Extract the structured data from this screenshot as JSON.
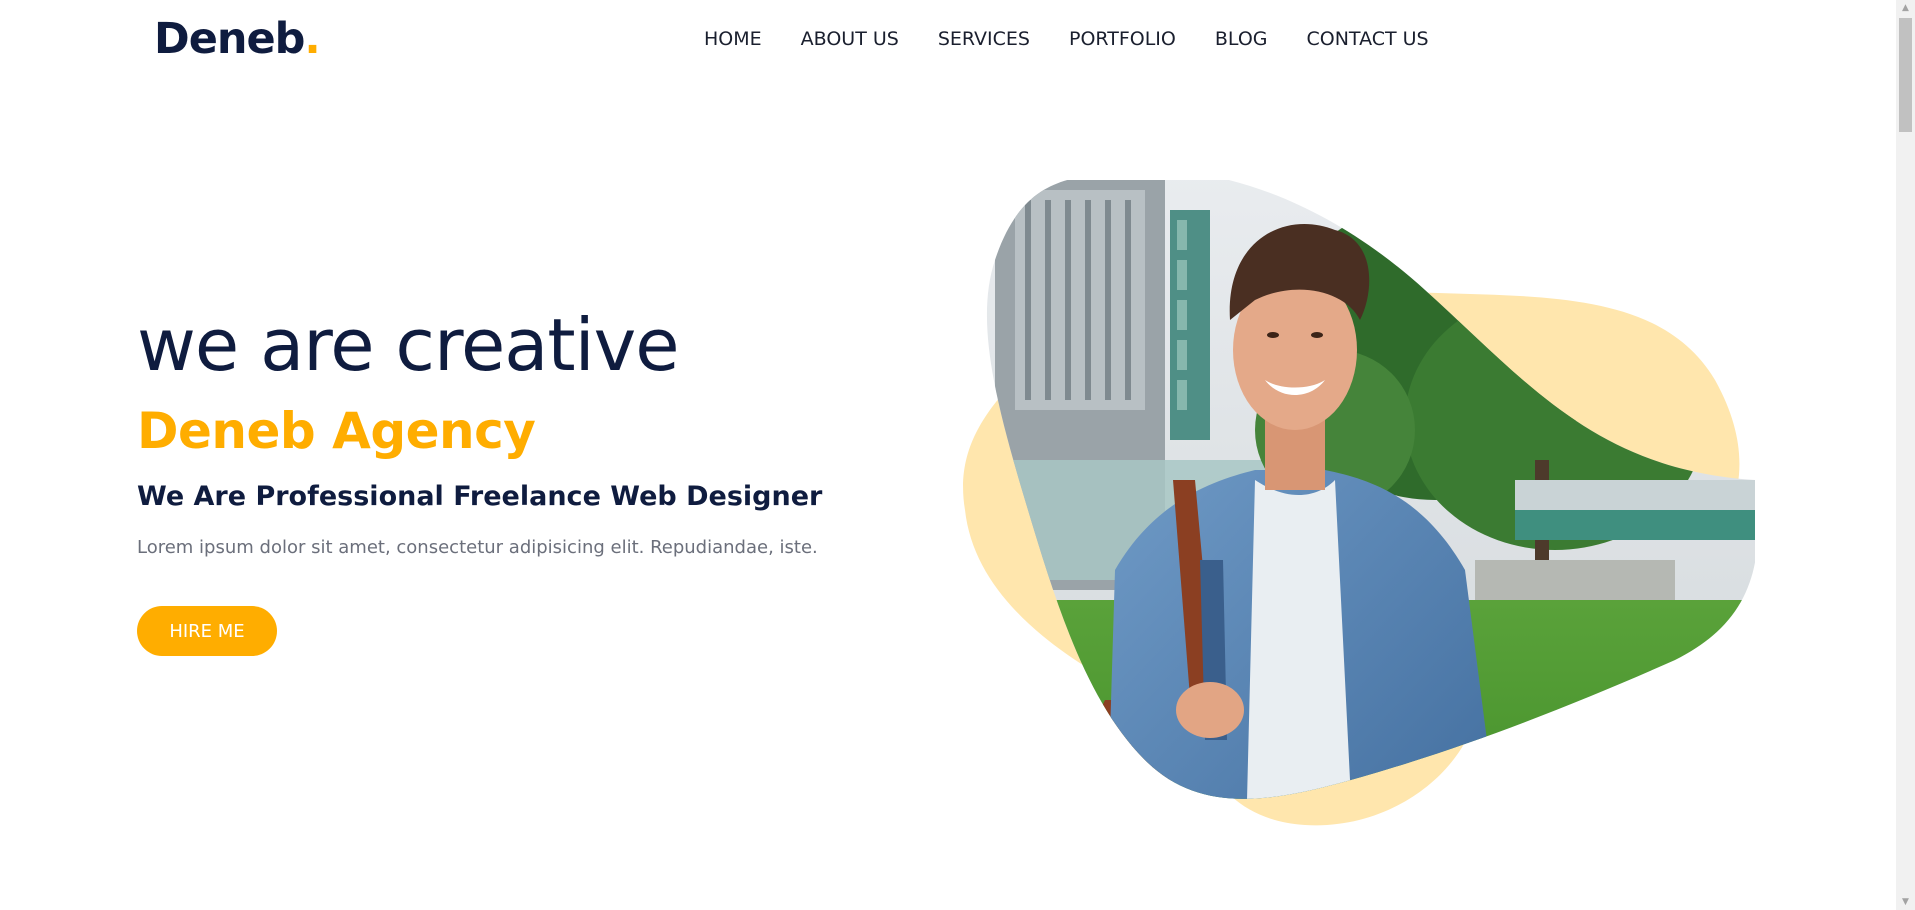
{
  "brand": {
    "name": "Deneb",
    "dot": "."
  },
  "nav": {
    "items": [
      {
        "label": "HOME"
      },
      {
        "label": "ABOUT US"
      },
      {
        "label": "SERVICES"
      },
      {
        "label": "PORTFOLIO"
      },
      {
        "label": "BLOG"
      },
      {
        "label": "CONTACT US"
      }
    ]
  },
  "hero": {
    "heading": "we are creative",
    "brand_line": "Deneb Agency",
    "subheading": "We Are Professional Freelance Web Designer",
    "description": "Lorem ipsum dolor sit amet, consectetur adipisicing elit. Repudiandae, iste.",
    "cta_label": "HIRE ME",
    "image_alt": "smiling-man-photo"
  },
  "colors": {
    "primary_dark": "#0f1c3f",
    "accent": "#ffad00",
    "blob": "#ffe6ad",
    "muted_text": "#6b6f7b"
  },
  "scrollbar": {
    "up_icon": "scroll-up-arrow-icon",
    "down_icon": "scroll-down-arrow-icon"
  }
}
